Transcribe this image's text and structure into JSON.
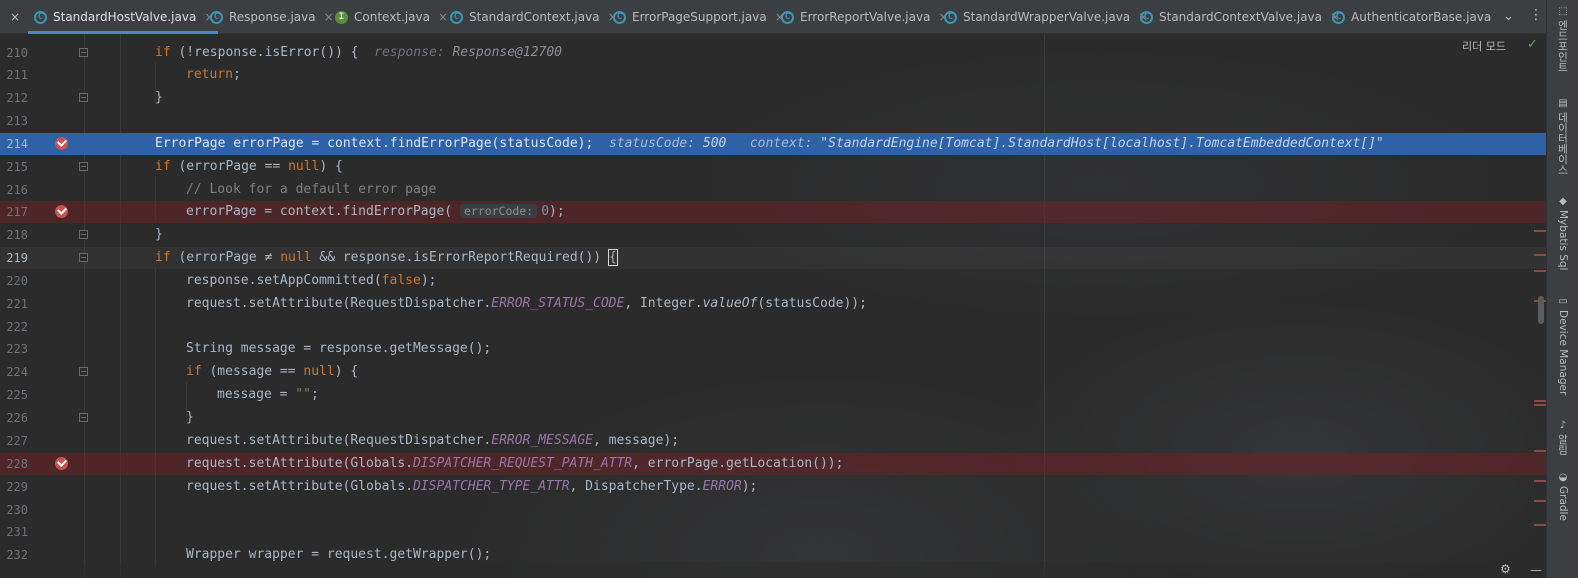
{
  "tabs": [
    {
      "label": "StandardHostValve.java",
      "kind": "class",
      "active": true,
      "close": true
    },
    {
      "label": "Response.java",
      "kind": "class",
      "close": true
    },
    {
      "label": "Context.java",
      "kind": "interface",
      "close": true
    },
    {
      "label": "StandardContext.java",
      "kind": "class",
      "close": true
    },
    {
      "label": "ErrorPageSupport.java",
      "kind": "class",
      "close": true
    },
    {
      "label": "ErrorReportValve.java",
      "kind": "class",
      "close": true
    },
    {
      "label": "StandardWrapperValve.java",
      "kind": "class",
      "close": true
    },
    {
      "label": "StandardContextValve.java",
      "kind": "class",
      "close": true
    },
    {
      "label": "AuthenticatorBase.java",
      "kind": "class",
      "close": false
    }
  ],
  "tab_close_glyph": "×",
  "reader_mode": "리더 모드",
  "lines": {
    "l210": {
      "num": "210",
      "hint_label": "response:",
      "hint_value": "Response@12700"
    },
    "l211": {
      "num": "211"
    },
    "l212": {
      "num": "212"
    },
    "l213": {
      "num": "213"
    },
    "l214": {
      "num": "214",
      "hint1_label": "statusCode:",
      "hint1_value": "500",
      "hint2_label": "context:",
      "hint2_value": "\"StandardEngine[Tomcat].StandardHost[localhost].TomcatEmbeddedContext[]\""
    },
    "l215": {
      "num": "215"
    },
    "l216": {
      "num": "216",
      "comment": "// Look for a default error page"
    },
    "l217": {
      "num": "217",
      "param_hint": "errorCode:",
      "value": "0"
    },
    "l218": {
      "num": "218"
    },
    "l219": {
      "num": "219"
    },
    "l220": {
      "num": "220"
    },
    "l221": {
      "num": "221"
    },
    "l222": {
      "num": "222"
    },
    "l223": {
      "num": "223"
    },
    "l224": {
      "num": "224"
    },
    "l225": {
      "num": "225",
      "string": "\"\""
    },
    "l226": {
      "num": "226"
    },
    "l227": {
      "num": "227"
    },
    "l228": {
      "num": "228"
    },
    "l229": {
      "num": "229"
    },
    "l230": {
      "num": "230"
    },
    "l231": {
      "num": "231"
    },
    "l232": {
      "num": "232"
    }
  },
  "right_tools": [
    {
      "icon": "bookmark-icon",
      "glyph": "⬚",
      "label": "엔드포인트"
    },
    {
      "icon": "database-icon",
      "glyph": "▤",
      "label": "데이터베이스"
    },
    {
      "icon": "mybatis-icon",
      "glyph": "◆",
      "label": "Mybatis Sql"
    },
    {
      "icon": "device-icon",
      "glyph": "▭",
      "label": "Device Manager"
    },
    {
      "icon": "bell-icon",
      "glyph": "♪",
      "label": "알림"
    },
    {
      "icon": "gradle-icon",
      "glyph": "◒",
      "label": "Gradle"
    }
  ],
  "colors": {
    "accent": "#4a88c7",
    "exec_line": "#2e61a6",
    "breakpoint": "#c75450"
  }
}
